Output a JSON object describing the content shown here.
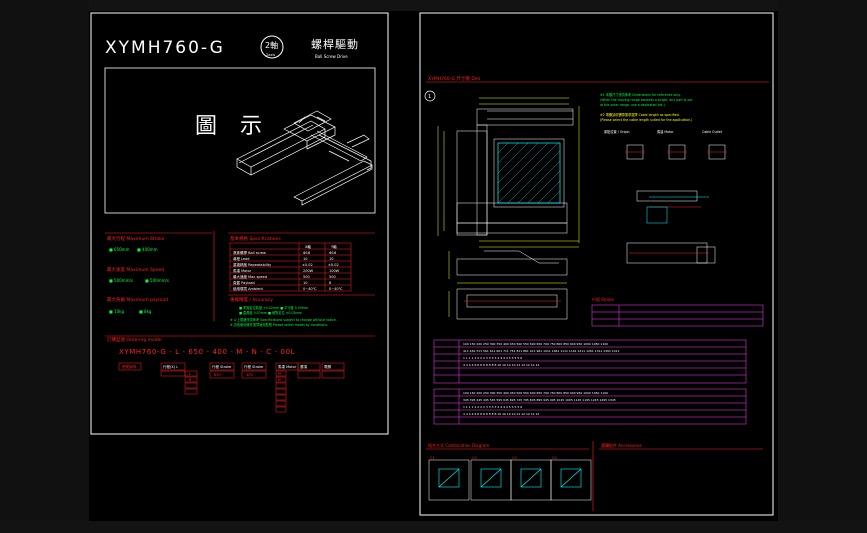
{
  "left_sheet": {
    "model_title": "XYMH760-G",
    "axis_badge": "2軸",
    "axis_badge_sub": "2axis",
    "drive_title": "螺桿驅動",
    "drive_subtitle": "Ball Screw Drive",
    "figure_label": "圖 示",
    "sections": {
      "max_stroke": "最大行程 Maximum Stroke",
      "max_speed": "最大速度 Maximum Speed",
      "max_payload": "最大負載 Maximum payload",
      "specifications": "基本規格 Specifications",
      "tolerance": "重複精度 / Accuracy",
      "ordering": "訂購型號 Ordering model"
    },
    "order_code": "XYMH760-G - L - 650 - 400 - M - N - C - 00L",
    "order_boxes": [
      "型號",
      "行程",
      "馬達",
      "選項",
      "電纜"
    ]
  },
  "right_sheet": {
    "dimension_title": "XYMH760-G 尺寸圖 Dim",
    "note_number": "1",
    "stroke_table_title": "行程 Stroke",
    "combination_title": "組合方式 Combination Diagram",
    "accessories_title": "選購配件 Accessories",
    "combo_labels": [
      "C1",
      "C2",
      "C3",
      "C4"
    ]
  },
  "colors": {
    "sheet_border": "#ffffff",
    "accent_red": "#ff2020",
    "accent_green": "#00ff40",
    "accent_yellow": "#ffff00",
    "accent_magenta": "#ff40ff",
    "accent_cyan": "#00ffff"
  }
}
